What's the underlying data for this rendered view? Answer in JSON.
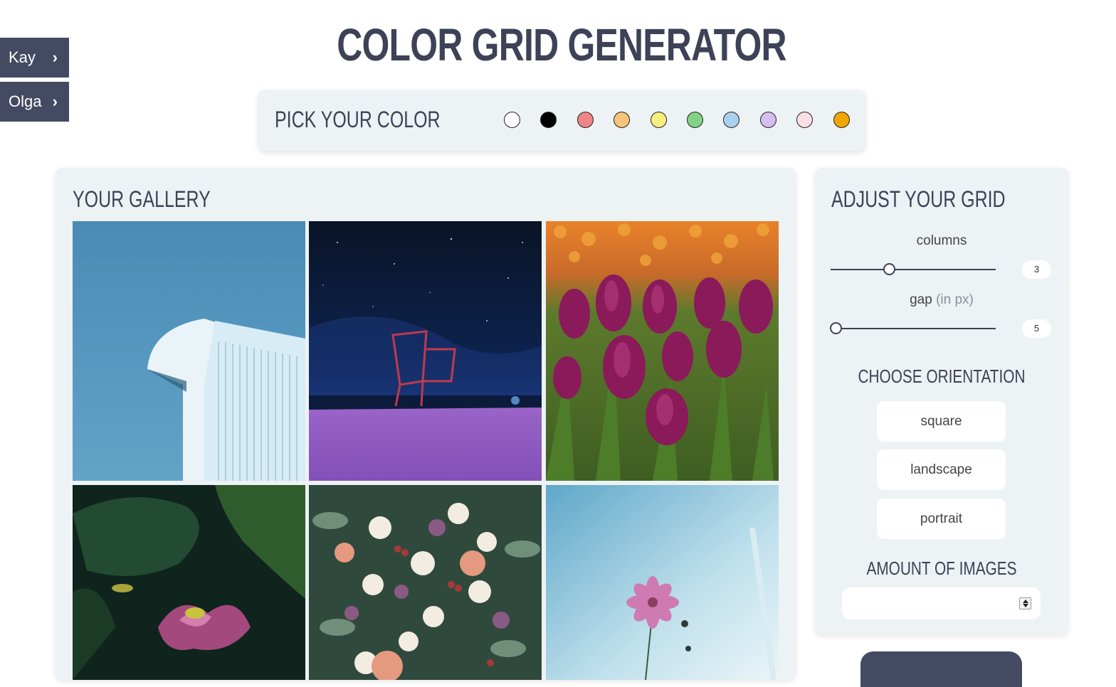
{
  "header": {
    "title": "COLOR GRID GENERATOR"
  },
  "side_tabs": [
    {
      "label": "Kay"
    },
    {
      "label": "Olga"
    }
  ],
  "picker": {
    "label": "PICK YOUR COLOR",
    "colors": [
      {
        "name": "white",
        "hex": "#ffffff"
      },
      {
        "name": "black",
        "hex": "#000000"
      },
      {
        "name": "red",
        "hex": "#ef8585"
      },
      {
        "name": "orange",
        "hex": "#f7c27a"
      },
      {
        "name": "yellow",
        "hex": "#f5f07e"
      },
      {
        "name": "green",
        "hex": "#82d285"
      },
      {
        "name": "blue",
        "hex": "#a9d1ee"
      },
      {
        "name": "purple",
        "hex": "#d6bdf0"
      },
      {
        "name": "pink",
        "hex": "#fbdfe6"
      },
      {
        "name": "gold",
        "hex": "#f0a500"
      }
    ]
  },
  "gallery": {
    "title": "YOUR GALLERY",
    "images": [
      {
        "subject": "white metal building against blue sky"
      },
      {
        "subject": "shopping cart on purple ground under starry night"
      },
      {
        "subject": "purple tulip field"
      },
      {
        "subject": "pink lotus flower among dark leaves"
      },
      {
        "subject": "flower bouquet roses"
      },
      {
        "subject": "pink cosmos flower against pale sky"
      }
    ]
  },
  "controls": {
    "title": "ADJUST YOUR GRID",
    "columns": {
      "label": "columns",
      "value": "3",
      "level": 0.35
    },
    "gap": {
      "label": "gap",
      "unit": "(in px)",
      "value": "5",
      "level": 0.0
    },
    "orientation": {
      "heading": "CHOOSE ORIENTATION",
      "options": [
        "square",
        "landscape",
        "portrait"
      ]
    },
    "amount": {
      "heading": "AMOUNT OF IMAGES",
      "value": ""
    }
  },
  "accent": "#454a63",
  "panel_bg": "#edf2f5"
}
